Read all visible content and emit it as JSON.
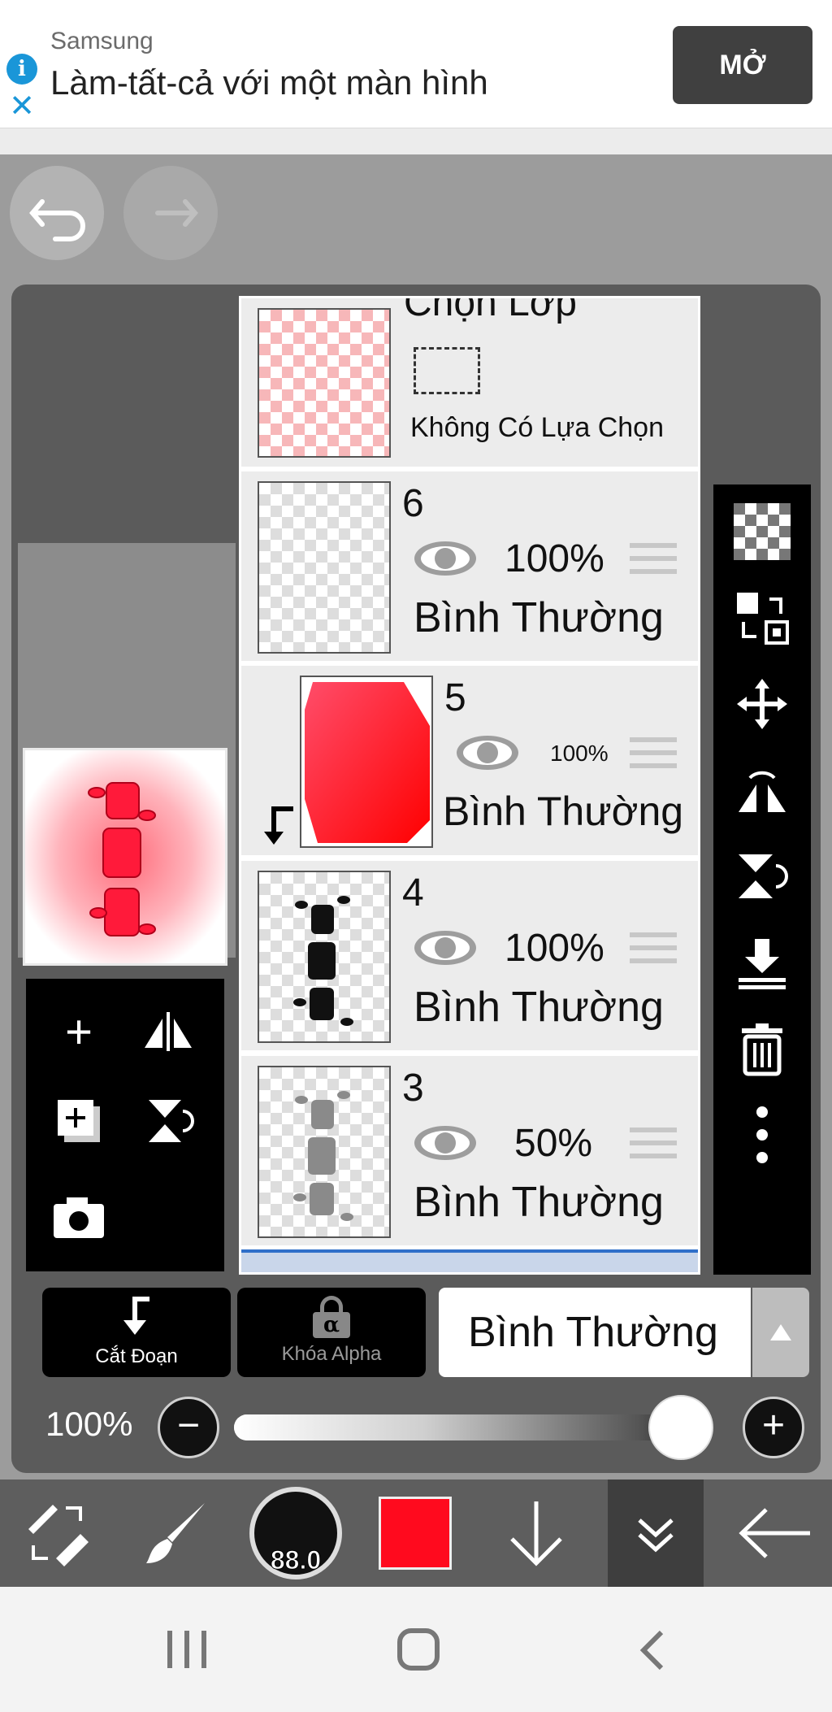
{
  "ad": {
    "brand": "Samsung",
    "headline": "Làm-tất-cả với một màn hình",
    "open_label": "MỞ"
  },
  "layers": {
    "selection": {
      "title": "Chọn Lớp",
      "status": "Không Có Lựa Chọn"
    },
    "items": [
      {
        "name": "6",
        "opacity": "100%",
        "mode": "Bình Thường"
      },
      {
        "name": "5",
        "opacity": "100%",
        "mode": "Bình Thường"
      },
      {
        "name": "4",
        "opacity": "100%",
        "mode": "Bình Thường"
      },
      {
        "name": "3",
        "opacity": "50%",
        "mode": "Bình Thường"
      }
    ]
  },
  "controls": {
    "clip_label": "Cắt Đoạn",
    "alpha_lock_label": "Khóa Alpha",
    "alpha_symbol": "α",
    "blend_mode": "Bình Thường",
    "opacity_label": "100%",
    "opacity_value": 1.0
  },
  "toolbar": {
    "brush_size": "88.0",
    "color": "#ff0a1e"
  },
  "colors": {
    "accent_red": "#ff0a1e",
    "ad_button": "#404040",
    "info_blue": "#1a96d8"
  }
}
